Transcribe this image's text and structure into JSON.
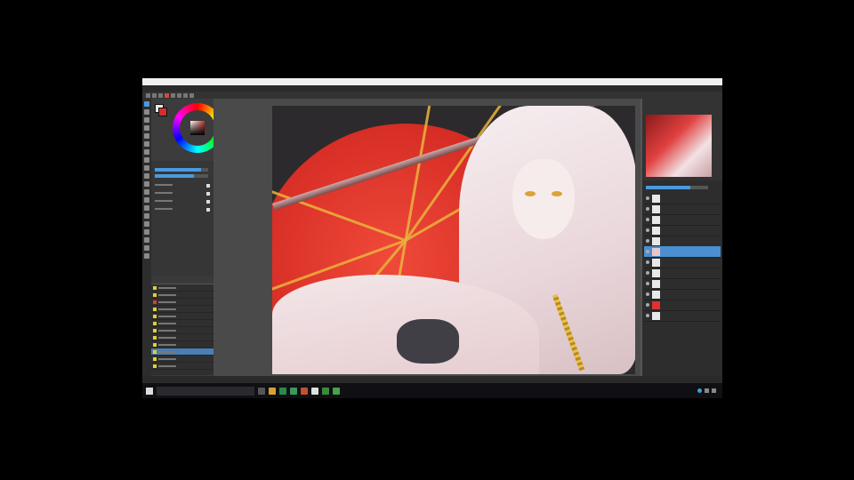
{
  "window": {
    "title": ""
  },
  "menu": {
    "items": [
      "",
      "",
      "",
      "",
      "",
      "",
      "",
      "",
      "",
      ""
    ]
  },
  "toolbar": {
    "info": ""
  },
  "status": {
    "text": ""
  },
  "taskbar": {
    "search_placeholder": "",
    "clock_time": "",
    "clock_date": ""
  },
  "colors": {
    "accent": "#4a9ae0",
    "foreground": "#e8e8e8",
    "background": "#d03030",
    "selected_layer": "#4a90d0"
  },
  "layers": {
    "selected_index": 6,
    "items": [
      {
        "thumb": "white"
      },
      {
        "thumb": "white"
      },
      {
        "thumb": "white"
      },
      {
        "thumb": "white"
      },
      {
        "thumb": "white"
      },
      {
        "thumb": "white"
      },
      {
        "thumb": "art"
      },
      {
        "thumb": "white"
      },
      {
        "thumb": "white"
      },
      {
        "thumb": "white"
      },
      {
        "thumb": "white"
      },
      {
        "thumb": "red"
      },
      {
        "thumb": "white"
      }
    ]
  },
  "icons": [
    "pen-tool-icon",
    "eraser-icon",
    "fill-icon",
    "selection-icon",
    "move-icon",
    "eyedropper-icon",
    "hand-icon",
    "zoom-icon"
  ]
}
